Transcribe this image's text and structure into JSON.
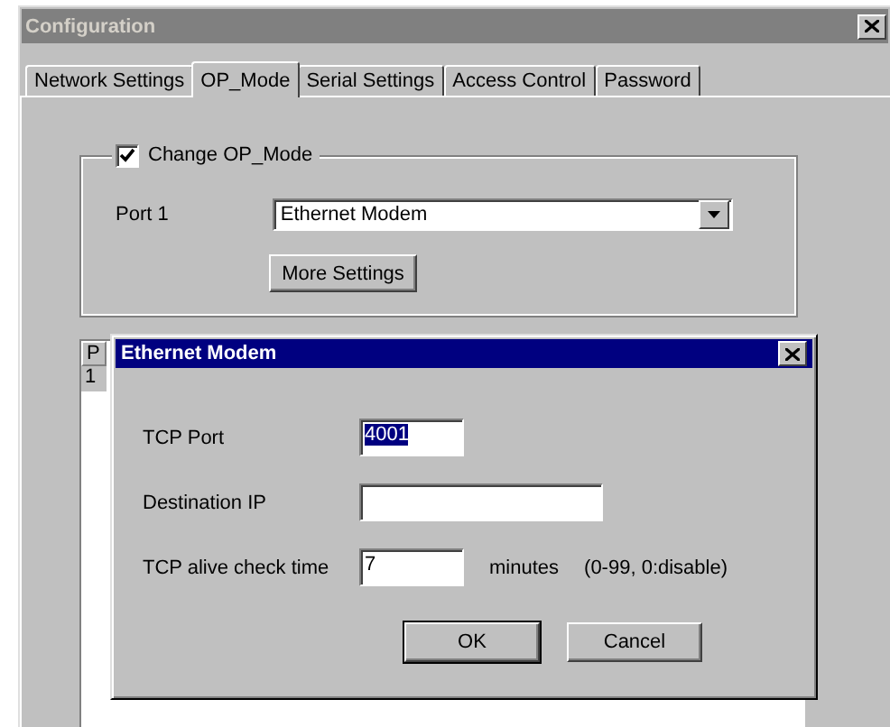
{
  "window": {
    "title": "Configuration"
  },
  "tabs": [
    {
      "label": "Network Settings",
      "selected": false
    },
    {
      "label": "OP_Mode",
      "selected": true
    },
    {
      "label": "Serial Settings",
      "selected": false
    },
    {
      "label": "Access Control",
      "selected": false
    },
    {
      "label": "Password",
      "selected": false
    }
  ],
  "op_mode_group": {
    "checkbox_label": "Change OP_Mode",
    "checked": true,
    "port_label": "Port 1",
    "port_value": "Ethernet Modem",
    "more_button": "More Settings"
  },
  "list": {
    "column_1": "P",
    "rows": [
      "1"
    ]
  },
  "dialog": {
    "title": "Ethernet Modem",
    "fields": [
      {
        "label": "TCP Port",
        "value": "4001",
        "highlighted": true,
        "wide": false
      },
      {
        "label": "Destination IP",
        "wide": true
      },
      {
        "label": "TCP alive check time",
        "value": "7",
        "highlighted": false,
        "wide": false,
        "unit": "minutes",
        "hint": "(0-99, 0:disable)"
      }
    ],
    "buttons": [
      {
        "label": "OK",
        "default": true
      },
      {
        "label": "Cancel",
        "default": false
      }
    ]
  }
}
